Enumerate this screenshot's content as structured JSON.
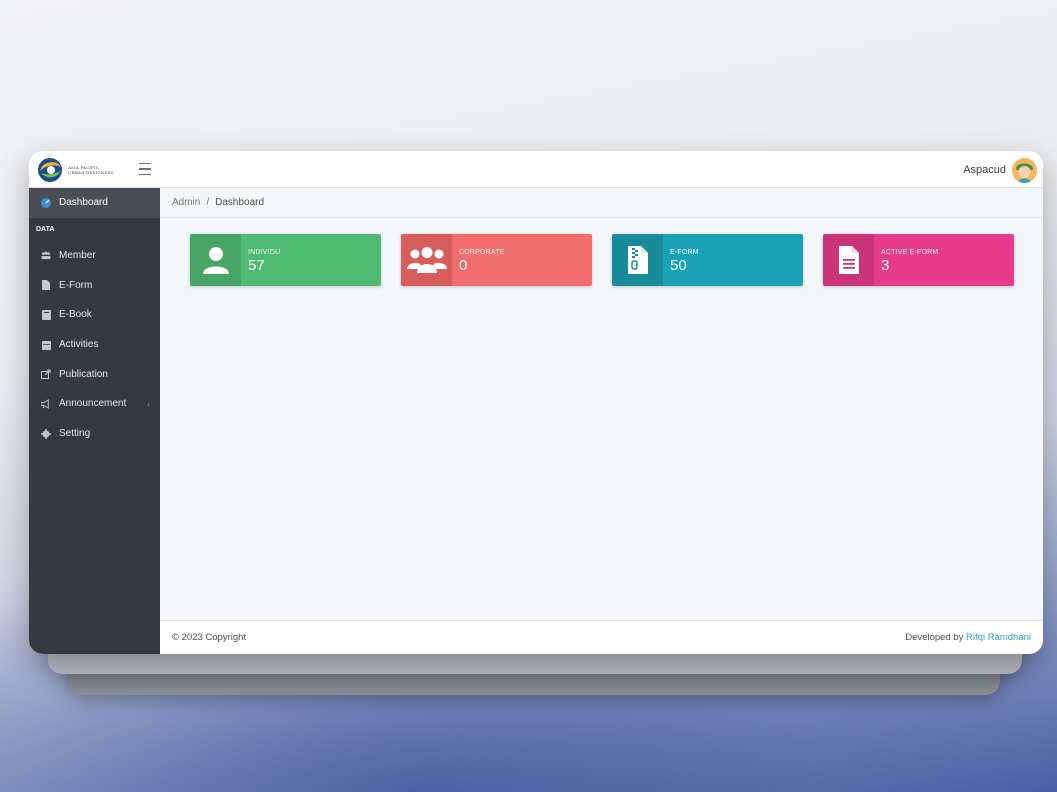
{
  "app": {
    "logo_lines": [
      "ASIA PACIFIC",
      "URBAN DESIGNERS"
    ]
  },
  "topbar": {
    "user_name": "Aspacud"
  },
  "breadcrumb": {
    "root": "Admin",
    "separator": "/",
    "current": "Dashboard"
  },
  "sidebar": {
    "active": {
      "label": "Dashboard",
      "icon": "dashboard-icon"
    },
    "section_header": "DATA",
    "items": [
      {
        "label": "Member",
        "icon": "users-icon"
      },
      {
        "label": "E-Form",
        "icon": "file-icon"
      },
      {
        "label": "E-Book",
        "icon": "book-icon"
      },
      {
        "label": "Activities",
        "icon": "calendar-icon"
      },
      {
        "label": "Publication",
        "icon": "share-icon"
      },
      {
        "label": "Announcement",
        "icon": "megaphone-icon"
      },
      {
        "label": "Setting",
        "icon": "gear-icon"
      }
    ],
    "announcement_chevron": "‹"
  },
  "stats": [
    {
      "label": "INDIVIDU",
      "value": "57",
      "icon": "user-icon",
      "color_icon": "#46a565",
      "color_body": "#4fbb72"
    },
    {
      "label": "CORPORATE",
      "value": "0",
      "icon": "users-group-icon",
      "color_icon": "#d75d5d",
      "color_body": "#f26d6d"
    },
    {
      "label": "E-FORM",
      "value": "50",
      "icon": "zip-file-icon",
      "color_icon": "#178b9a",
      "color_body": "#18a2b4"
    },
    {
      "label": "ACTIVE E-FORM",
      "value": "3",
      "icon": "document-icon",
      "color_icon": "#cb3478",
      "color_body": "#e63c8b"
    }
  ],
  "footer": {
    "copyright": "© 2023 Copyright",
    "developed_by": "Developed by",
    "developer": "Rifqi Ramdhani"
  },
  "colors": {
    "sidebar_bg": "#343a40",
    "sidebar_active": "#494e53",
    "link": "#2e9fd8"
  }
}
